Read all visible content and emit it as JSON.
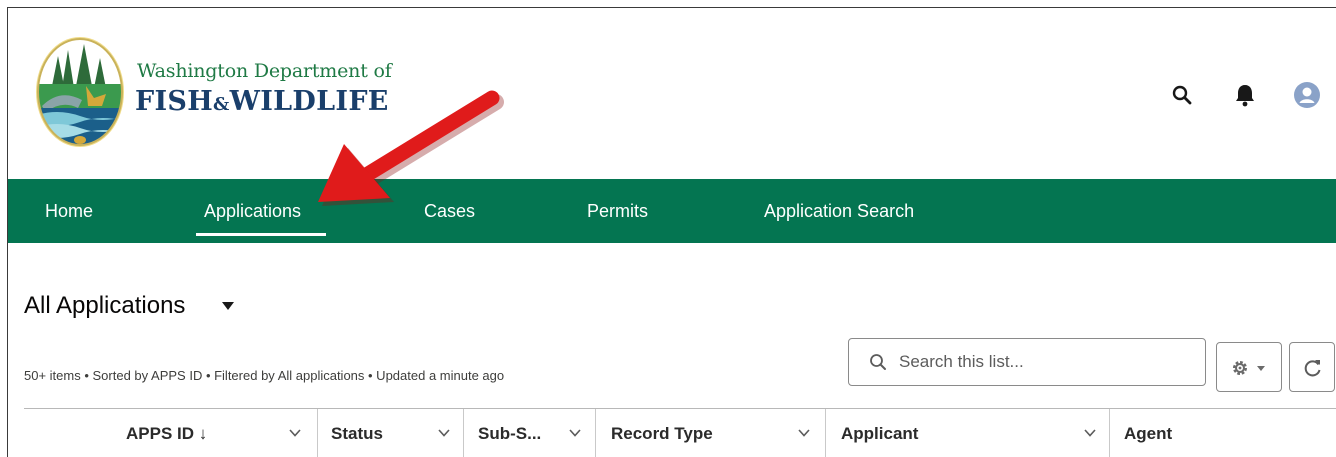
{
  "header": {
    "org_line1": "Washington Department of",
    "org_line2_a": "FISH",
    "org_line2_amp": "&",
    "org_line2_b": "WILDLIFE",
    "icons": [
      "search-icon",
      "bell-icon",
      "user-avatar-icon"
    ]
  },
  "nav": {
    "items": [
      {
        "label": "Home",
        "active": false
      },
      {
        "label": "Applications",
        "active": true
      },
      {
        "label": "Cases",
        "active": false
      },
      {
        "label": "Permits",
        "active": false
      },
      {
        "label": "Application Search",
        "active": false
      }
    ]
  },
  "annotation": {
    "type": "arrow",
    "color": "#e01b1b",
    "points_to": "Applications"
  },
  "list": {
    "title": "All Applications",
    "meta": "50+ items • Sorted by APPS ID • Filtered by All applications • Updated a minute ago",
    "search_placeholder": "Search this list..."
  },
  "table": {
    "columns": [
      {
        "label": "APPS ID ↓"
      },
      {
        "label": "Status"
      },
      {
        "label": "Sub-S..."
      },
      {
        "label": "Record Type"
      },
      {
        "label": "Applicant"
      },
      {
        "label": "Agent"
      }
    ]
  },
  "colors": {
    "nav_bg": "#047551",
    "brand_green": "#1f7a45",
    "brand_blue": "#1a3f6b",
    "arrow": "#e01b1b"
  }
}
